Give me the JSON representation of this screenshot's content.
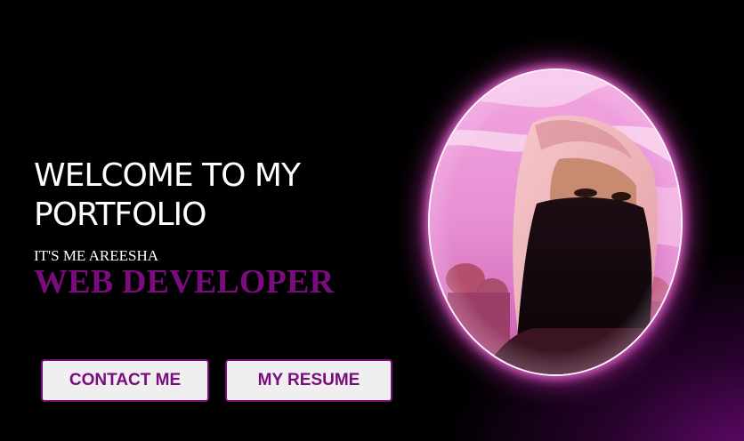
{
  "hero": {
    "heading": "WELCOME TO MY PORTFOLIO",
    "intro": "IT'S ME AREESHA",
    "role": "WEB DEVELOPER"
  },
  "actions": {
    "contact_label": "CONTACT ME",
    "resume_label": "MY RESUME"
  },
  "colors": {
    "accent": "#7a0c7e",
    "background": "#000000",
    "glow": "#ff78e6",
    "button_bg": "#f0eff0"
  },
  "avatar": {
    "alt": "profile photo"
  }
}
